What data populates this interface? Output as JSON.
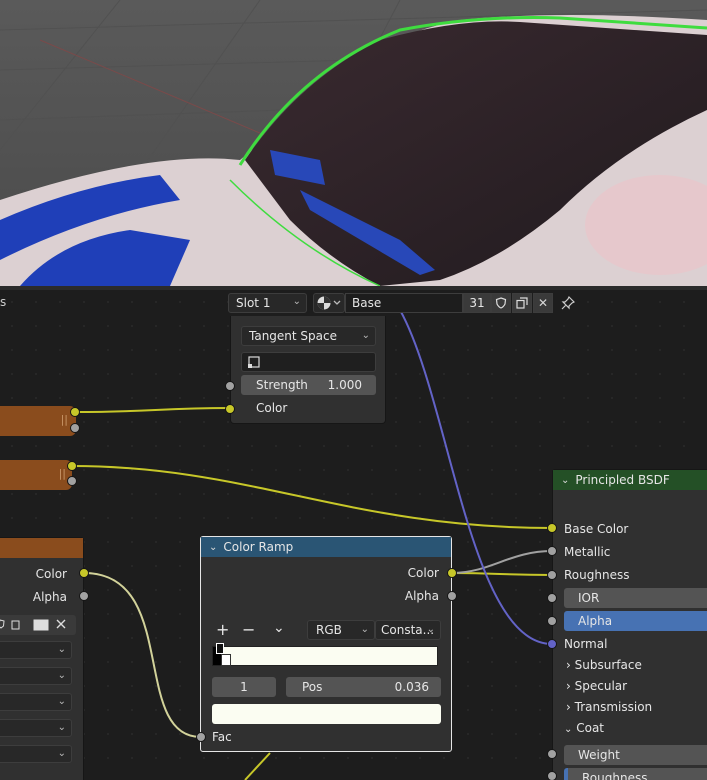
{
  "header": {
    "left_truncated": "s",
    "slot": "Slot 1",
    "material_name": "Base",
    "user_count": "31"
  },
  "normal_map": {
    "space_option": "Tangent Space",
    "strength_label": "Strength",
    "strength_value": "1.000",
    "color_socket": "Color"
  },
  "image_node": {
    "color": "Color",
    "alpha": "Alpha"
  },
  "color_ramp": {
    "title": "Color Ramp",
    "out_color": "Color",
    "out_alpha": "Alpha",
    "add": "+",
    "remove": "−",
    "color_mode": "RGB",
    "interpolation": "Consta...",
    "stop_index": "1",
    "pos_label": "Pos",
    "pos_value": "0.036",
    "fac": "Fac"
  },
  "principled": {
    "title": "Principled BSDF",
    "base_color": "Base Color",
    "metallic": "Metallic",
    "roughness": "Roughness",
    "ior": "IOR",
    "alpha": "Alpha",
    "normal": "Normal",
    "subsurface": "Subsurface",
    "specular": "Specular",
    "transmission": "Transmission",
    "coat": "Coat",
    "coat_weight": "Weight",
    "coat_roughness": "Roughness"
  },
  "colors": {
    "editor_bg": "#1d1d1d",
    "node_bg": "#303030",
    "field_bg": "#545454",
    "color_ramp_header": "#2a5574",
    "principled_header": "#245026",
    "frame_orange": "#8a4c1d",
    "socket_yellow": "#c7c729",
    "socket_grey": "#a1a1a1",
    "socket_purple": "#6363c7",
    "alpha_highlight": "#4772b3",
    "selection_outline": "#3fdc3f"
  },
  "icons": [
    "chevron-down-icon",
    "material-sphere-icon",
    "fake-user-shield-icon",
    "duplicate-icon",
    "close-icon",
    "pin-icon",
    "image-icon",
    "folder-icon",
    "plus-icon",
    "minus-icon"
  ]
}
